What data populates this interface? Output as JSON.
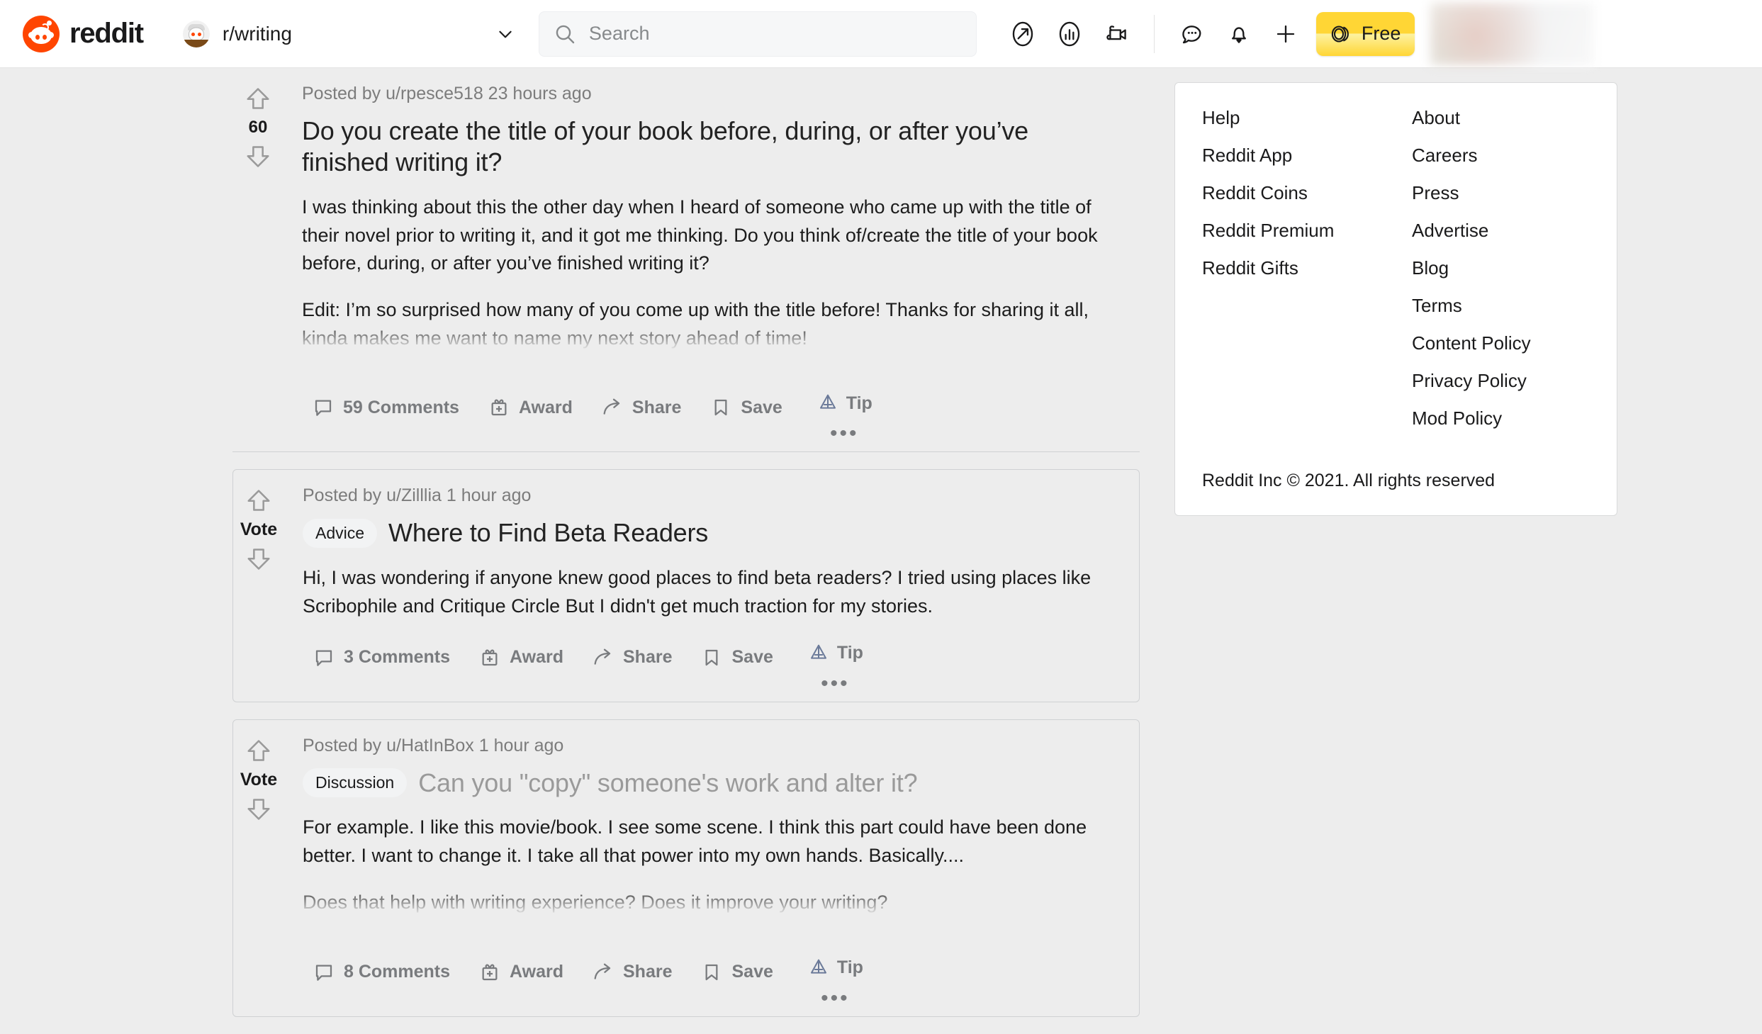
{
  "header": {
    "brand": "reddit",
    "brand_color": "#ff4500",
    "subreddit": "r/writing",
    "search_placeholder": "Search",
    "icons": [
      {
        "name": "popular-icon",
        "label": "Popular"
      },
      {
        "name": "trending-chart-icon",
        "label": "Trending"
      },
      {
        "name": "video-icon",
        "label": "Video"
      },
      {
        "name": "chat-icon",
        "label": "Chat"
      },
      {
        "name": "notifications-bell-icon",
        "label": "Notifications"
      },
      {
        "name": "create-post-plus-icon",
        "label": "Create Post"
      }
    ],
    "coin_button": {
      "label": "Free",
      "background": "#ffd635"
    }
  },
  "feed": {
    "posts": [
      {
        "meta": "Posted by u/rpesce518 23 hours ago",
        "author": "u/rpesce518",
        "age": "23 hours ago",
        "flair": null,
        "title": "Do you create the title of your book before, during, or after you’ve finished writing it?",
        "title_visited": false,
        "vote_score": "60",
        "body": [
          "I was thinking about this the other day when I heard of someone who came up with the title of their novel prior to writing it, and it got me thinking. Do you think of/create the title of your book before, during, or after you’ve finished writing it?",
          "Edit: I’m so surprised how many of you come up with the title before! Thanks for sharing it all, kinda makes me want to name my next story ahead of time!"
        ],
        "comments_label": "59 Comments",
        "award_label": "Award",
        "share_label": "Share",
        "save_label": "Save",
        "tip_label": "Tip",
        "more_label": "•••"
      },
      {
        "meta": "Posted by u/Zilllia 1 hour ago",
        "author": "u/Zilllia",
        "age": "1 hour ago",
        "flair": "Advice",
        "title": "Where to Find Beta Readers",
        "title_visited": false,
        "vote_score": "Vote",
        "body": [
          "Hi, I was wondering if anyone knew good places to find beta readers? I tried using places like Scribophile and Critique Circle But I didn't get much traction for my stories."
        ],
        "comments_label": "3 Comments",
        "award_label": "Award",
        "share_label": "Share",
        "save_label": "Save",
        "tip_label": "Tip",
        "more_label": "•••"
      },
      {
        "meta": "Posted by u/HatInBox 1 hour ago",
        "author": "u/HatInBox",
        "age": "1 hour ago",
        "flair": "Discussion",
        "title": "Can you \"copy\" someone's work and alter it?",
        "title_visited": true,
        "vote_score": "Vote",
        "body": [
          "For example. I like this movie/book. I see some scene. I think this part could have been done better. I want to change it. I take all that power into my own hands. Basically....",
          "Does that help with writing experience? Does it improve your writing?"
        ],
        "comments_label": "8 Comments",
        "award_label": "Award",
        "share_label": "Share",
        "save_label": "Save",
        "tip_label": "Tip",
        "more_label": "•••"
      }
    ]
  },
  "sidebar": {
    "col1": [
      "Help",
      "Reddit App",
      "Reddit Coins",
      "Reddit Premium",
      "Reddit Gifts"
    ],
    "col2": [
      "About",
      "Careers",
      "Press",
      "Advertise",
      "Blog",
      "Terms",
      "Content Policy",
      "Privacy Policy",
      "Mod Policy"
    ],
    "copyright": "Reddit Inc © 2021. All rights reserved"
  }
}
